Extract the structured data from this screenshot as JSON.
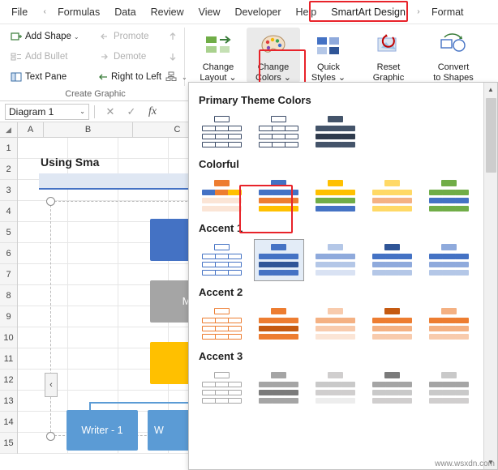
{
  "ribbon": {
    "tabs": [
      {
        "label": "File",
        "name": "tab-file"
      },
      {
        "label": "Formulas",
        "name": "tab-formulas"
      },
      {
        "label": "Data",
        "name": "tab-data"
      },
      {
        "label": "Review",
        "name": "tab-review"
      },
      {
        "label": "View",
        "name": "tab-view"
      },
      {
        "label": "Developer",
        "name": "tab-developer"
      },
      {
        "label": "Help",
        "name": "tab-help"
      },
      {
        "label": "SmartArt Design",
        "name": "tab-smartart-design"
      },
      {
        "label": "Format",
        "name": "tab-format"
      }
    ],
    "left_scroll_glyph": "‹",
    "right_scroll_glyph": "›",
    "create_graphic": {
      "group_label": "Create Graphic",
      "add_shape": "Add Shape",
      "add_bullet": "Add Bullet",
      "text_pane": "Text Pane",
      "promote": "Promote",
      "demote": "Demote",
      "right_to_left": "Right to Left",
      "layout_label": "",
      "caret": "⌄"
    },
    "buttons": {
      "change_layout": "Change\nLayout",
      "change_layout_l1": "Change",
      "change_layout_l2": "Layout ⌄",
      "change_colors_l1": "Change",
      "change_colors_l2": "Colors ⌄",
      "quick_styles_l1": "Quick",
      "quick_styles_l2": "Styles ⌄",
      "reset_graphic_l1": "Reset",
      "reset_graphic_l2": "Graphic",
      "convert_l1": "Convert",
      "convert_l2": "to Shapes"
    }
  },
  "formula_bar": {
    "name_box_value": "Diagram 1",
    "name_box_caret": "⌄",
    "cancel_icon": "✕",
    "enter_icon": "✓",
    "fx_icon": "fx"
  },
  "grid": {
    "select_all_glyph": "◢",
    "columns": [
      "A",
      "B",
      "C"
    ],
    "rows": [
      "1",
      "2",
      "3",
      "4",
      "5",
      "6",
      "7",
      "8",
      "9",
      "10",
      "11",
      "12",
      "13",
      "14",
      "15"
    ]
  },
  "canvas": {
    "title": "Using Sma",
    "collapse_glyph": "‹",
    "nodes": [
      {
        "label": "",
        "color": "#4472c4",
        "name": "smartart-node-top"
      },
      {
        "label": "M",
        "color": "#a5a5a5",
        "name": "smartart-node-manager"
      },
      {
        "label": "",
        "color": "#ffc000",
        "name": "smartart-node-editor"
      },
      {
        "label": "Writer - 1",
        "color": "#5b9bd5",
        "name": "smartart-node-writer-1"
      },
      {
        "label": "W",
        "color": "#5b9bd5",
        "name": "smartart-node-writer-2"
      }
    ]
  },
  "gallery": {
    "scroll_up": "▲",
    "scroll_down": "▼",
    "sections": [
      {
        "title": "Primary Theme Colors",
        "name": "section-primary-theme-colors",
        "items": [
          {
            "name": "swatch-dark-outline-1",
            "top": "#ffffff",
            "children": [
              "#ffffff",
              "#ffffff",
              "#ffffff"
            ],
            "border": "#3a4a66",
            "selected": false
          },
          {
            "name": "swatch-dark-outline-2",
            "top": "#ffffff",
            "children": [
              "#ffffff",
              "#ffffff",
              "#ffffff"
            ],
            "border": "#3a4a66",
            "selected": false
          },
          {
            "name": "swatch-dark-fill-3",
            "top": "#44546a",
            "children": [
              "#44546a",
              "#44546a",
              "#44546a"
            ],
            "border": "#44546a",
            "selected": false
          }
        ]
      },
      {
        "title": "Colorful",
        "name": "section-colorful",
        "items": [
          {
            "name": "swatch-colorful-1",
            "top": "#ed7d31",
            "children": [
              "#4472c4",
              "#ed7d31",
              "#ffc000"
            ],
            "border": "#d9d9d9",
            "selected": false
          },
          {
            "name": "swatch-colorful-2",
            "top": "#4472c4",
            "children": [
              "#4472c4",
              "#ed7d31",
              "#ffc000"
            ],
            "border": "#d9d9d9",
            "selected": true
          },
          {
            "name": "swatch-colorful-3",
            "top": "#ffc000",
            "children": [
              "#ffc000",
              "#70ad47",
              "#4472c4"
            ],
            "border": "#d9d9d9",
            "selected": false
          },
          {
            "name": "swatch-colorful-4",
            "top": "#ffd966",
            "children": [
              "#ffd966",
              "#f4b183",
              "#ffd966"
            ],
            "border": "#d9d9d9",
            "selected": false
          },
          {
            "name": "swatch-colorful-5",
            "top": "#70ad47",
            "children": [
              "#70ad47",
              "#4472c4",
              "#70ad47"
            ],
            "border": "#d9d9d9",
            "selected": false
          }
        ]
      },
      {
        "title": "Accent 1",
        "name": "section-accent-1",
        "items": [
          {
            "name": "swatch-accent1-1",
            "top": "#ffffff",
            "children": [
              "#ffffff",
              "#ffffff",
              "#ffffff"
            ],
            "border": "#4472c4",
            "selected": false
          },
          {
            "name": "swatch-accent1-2",
            "top": "#4472c4",
            "children": [
              "#4472c4",
              "#4472c4",
              "#4472c4"
            ],
            "border": "#4472c4",
            "selected": true
          },
          {
            "name": "swatch-accent1-3",
            "top": "#b4c7e7",
            "children": [
              "#8faadc",
              "#b4c7e7",
              "#d9e2f3"
            ],
            "border": "#b4c7e7",
            "selected": false
          },
          {
            "name": "swatch-accent1-4",
            "top": "#2f5597",
            "children": [
              "#4472c4",
              "#8faadc",
              "#b4c7e7"
            ],
            "border": "#2f5597",
            "selected": false
          },
          {
            "name": "swatch-accent1-5",
            "top": "#8faadc",
            "children": [
              "#4472c4",
              "#8faadc",
              "#b4c7e7"
            ],
            "border": "#8faadc",
            "selected": false
          }
        ]
      },
      {
        "title": "Accent 2",
        "name": "section-accent-2",
        "items": [
          {
            "name": "swatch-accent2-1",
            "top": "#ffffff",
            "children": [
              "#ffffff",
              "#ffffff",
              "#ffffff"
            ],
            "border": "#ed7d31",
            "selected": false
          },
          {
            "name": "swatch-accent2-2",
            "top": "#ed7d31",
            "children": [
              "#ed7d31",
              "#ed7d31",
              "#ed7d31"
            ],
            "border": "#ed7d31",
            "selected": false
          },
          {
            "name": "swatch-accent2-3",
            "top": "#f8cbad",
            "children": [
              "#f4b183",
              "#f8cbad",
              "#fbe5d6"
            ],
            "border": "#f8cbad",
            "selected": false
          },
          {
            "name": "swatch-accent2-4",
            "top": "#c55a11",
            "children": [
              "#ed7d31",
              "#f4b183",
              "#f8cbad"
            ],
            "border": "#c55a11",
            "selected": false
          },
          {
            "name": "swatch-accent2-5",
            "top": "#f4b183",
            "children": [
              "#ed7d31",
              "#f4b183",
              "#f8cbad"
            ],
            "border": "#f4b183",
            "selected": false
          }
        ]
      },
      {
        "title": "Accent 3",
        "name": "section-accent-3",
        "items": [
          {
            "name": "swatch-accent3-1",
            "top": "#ffffff",
            "children": [
              "#ffffff",
              "#ffffff",
              "#ffffff"
            ],
            "border": "#a5a5a5",
            "selected": false
          },
          {
            "name": "swatch-accent3-2",
            "top": "#a5a5a5",
            "children": [
              "#a5a5a5",
              "#a5a5a5",
              "#a5a5a5"
            ],
            "border": "#a5a5a5",
            "selected": false
          },
          {
            "name": "swatch-accent3-3",
            "top": "#d0cece",
            "children": [
              "#c9c9c9",
              "#d0cece",
              "#ededed"
            ],
            "border": "#d0cece",
            "selected": false
          },
          {
            "name": "swatch-accent3-4",
            "top": "#7b7b7b",
            "children": [
              "#a5a5a5",
              "#c9c9c9",
              "#d0cece"
            ],
            "border": "#7b7b7b",
            "selected": false
          },
          {
            "name": "swatch-accent3-5",
            "top": "#c9c9c9",
            "children": [
              "#a5a5a5",
              "#c9c9c9",
              "#d0cece"
            ],
            "border": "#c9c9c9",
            "selected": false
          }
        ]
      }
    ]
  },
  "watermark": "www.wsxdn.com"
}
